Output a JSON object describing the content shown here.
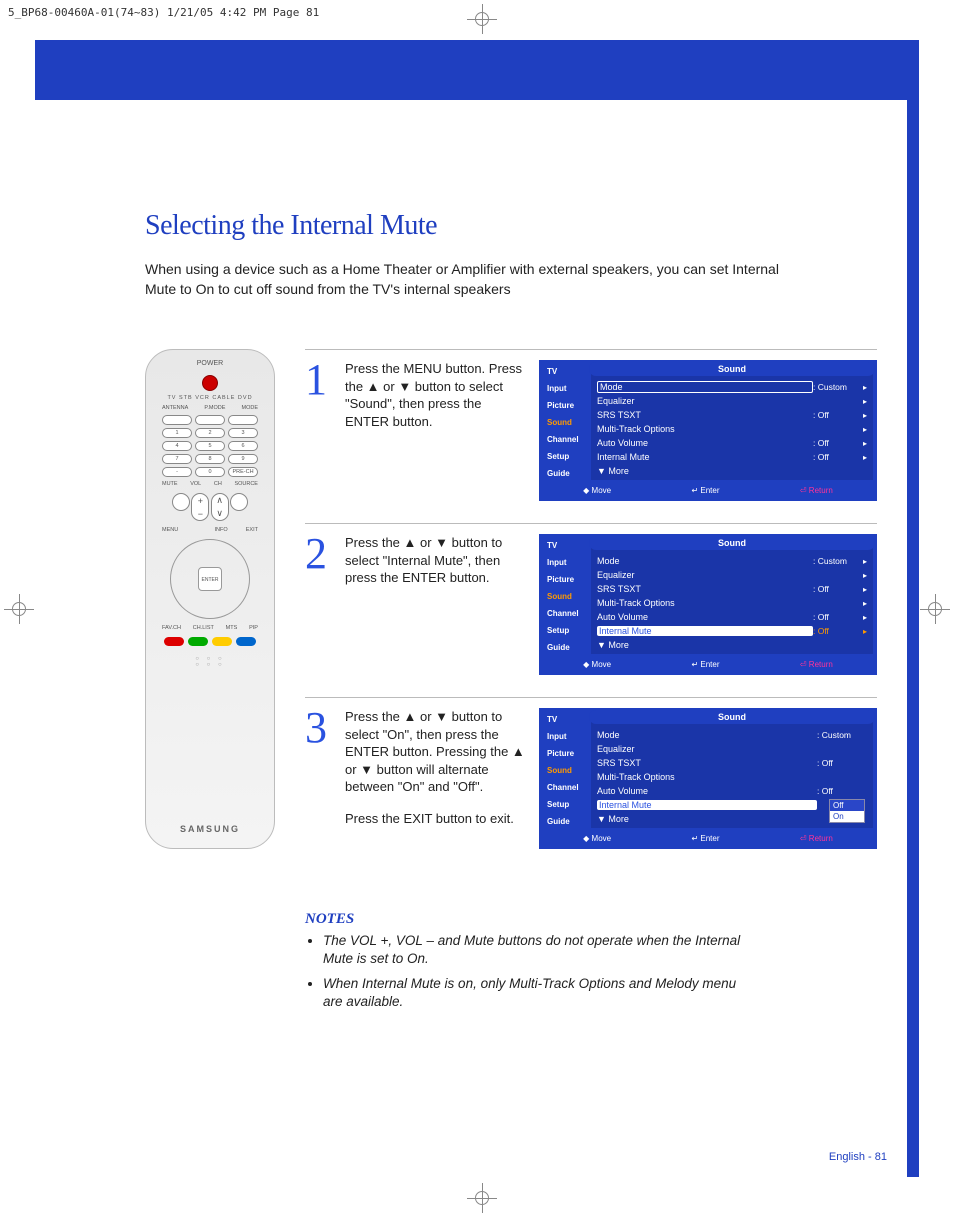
{
  "header_text": "5_BP68-00460A-01(74~83)  1/21/05  4:42 PM  Page 81",
  "title": "Selecting the Internal Mute",
  "intro": "When using a device such as a Home Theater or Amplifier with external speakers, you can set Internal Mute to On to cut off sound from the TV's internal speakers",
  "remote": {
    "power_label": "POWER",
    "top_labels": "TV  STB  VCR  CABLE  DVD",
    "label_antenna": "ANTENNA",
    "label_pmode": "P.MODE",
    "label_mode": "MODE",
    "num": [
      "1",
      "2",
      "3",
      "4",
      "5",
      "6",
      "7",
      "8",
      "9",
      "-",
      "0",
      "PRE-CH"
    ],
    "mute": "MUTE",
    "vol": "VOL",
    "ch": "CH",
    "source": "SOURCE",
    "info": "INFO",
    "menu": "MENU",
    "exit": "EXIT",
    "enter": "ENTER",
    "favch": "FAV.CH",
    "chlist": "CH.LIST",
    "mts": "MTS",
    "pip": "PIP",
    "brand": "SAMSUNG"
  },
  "steps": [
    {
      "num": "1",
      "text": "Press the MENU button. Press the ▲ or ▼ button to select \"Sound\", then press the ENTER button.",
      "osd": {
        "title": "Sound",
        "rows": [
          {
            "label": "Mode",
            "value": ": Custom",
            "box": true,
            "arrow": true
          },
          {
            "label": "Equalizer",
            "value": "",
            "arrow": true
          },
          {
            "label": "SRS TSXT",
            "value": ": Off",
            "arrow": true
          },
          {
            "label": "Multi-Track Options",
            "value": "",
            "arrow": true
          },
          {
            "label": "Auto Volume",
            "value": ": Off",
            "arrow": true
          },
          {
            "label": "Internal Mute",
            "value": ": Off",
            "arrow": true
          },
          {
            "label": "▼ More",
            "value": ""
          }
        ]
      }
    },
    {
      "num": "2",
      "text": "Press the ▲ or ▼ button to select \"Internal Mute\", then press the ENTER button.",
      "osd": {
        "title": "Sound",
        "rows": [
          {
            "label": "Mode",
            "value": ": Custom",
            "arrow": true
          },
          {
            "label": "Equalizer",
            "value": "",
            "arrow": true
          },
          {
            "label": "SRS TSXT",
            "value": ": Off",
            "arrow": true
          },
          {
            "label": "Multi-Track Options",
            "value": "",
            "arrow": true
          },
          {
            "label": "Auto Volume",
            "value": ": Off",
            "arrow": true
          },
          {
            "label": "Internal Mute",
            "value": ": Off",
            "highlight": true,
            "arrow": true
          },
          {
            "label": "▼ More",
            "value": ""
          }
        ]
      }
    },
    {
      "num": "3",
      "text": "Press the ▲ or ▼ button to select \"On\", then press the ENTER button. Pressing the ▲ or ▼ button will alternate between \"On\" and \"Off\".",
      "exit_text": "Press the EXIT button to exit.",
      "osd": {
        "title": "Sound",
        "rows": [
          {
            "label": "Mode",
            "value": ": Custom"
          },
          {
            "label": "Equalizer",
            "value": ""
          },
          {
            "label": "SRS TSXT",
            "value": ": Off"
          },
          {
            "label": "Multi-Track Options",
            "value": ""
          },
          {
            "label": "Auto Volume",
            "value": ": Off"
          },
          {
            "label": "Internal Mute",
            "value": "",
            "highlight_label": true
          },
          {
            "label": "▼ More",
            "value": ""
          }
        ],
        "popup": {
          "options": [
            "Off",
            "On"
          ],
          "selected": "On"
        }
      }
    }
  ],
  "osd_tabs": [
    "TV",
    "Input",
    "Picture",
    "Sound",
    "Channel",
    "Setup",
    "Guide"
  ],
  "osd_footer": {
    "move": "Move",
    "enter": "Enter",
    "return": "Return"
  },
  "notes_head": "NOTES",
  "notes": [
    "The VOL +, VOL – and Mute buttons do not operate when the Internal Mute is set to On.",
    "When Internal Mute is on, only Multi-Track Options and Melody menu are available."
  ],
  "page_footer": "English - 81"
}
